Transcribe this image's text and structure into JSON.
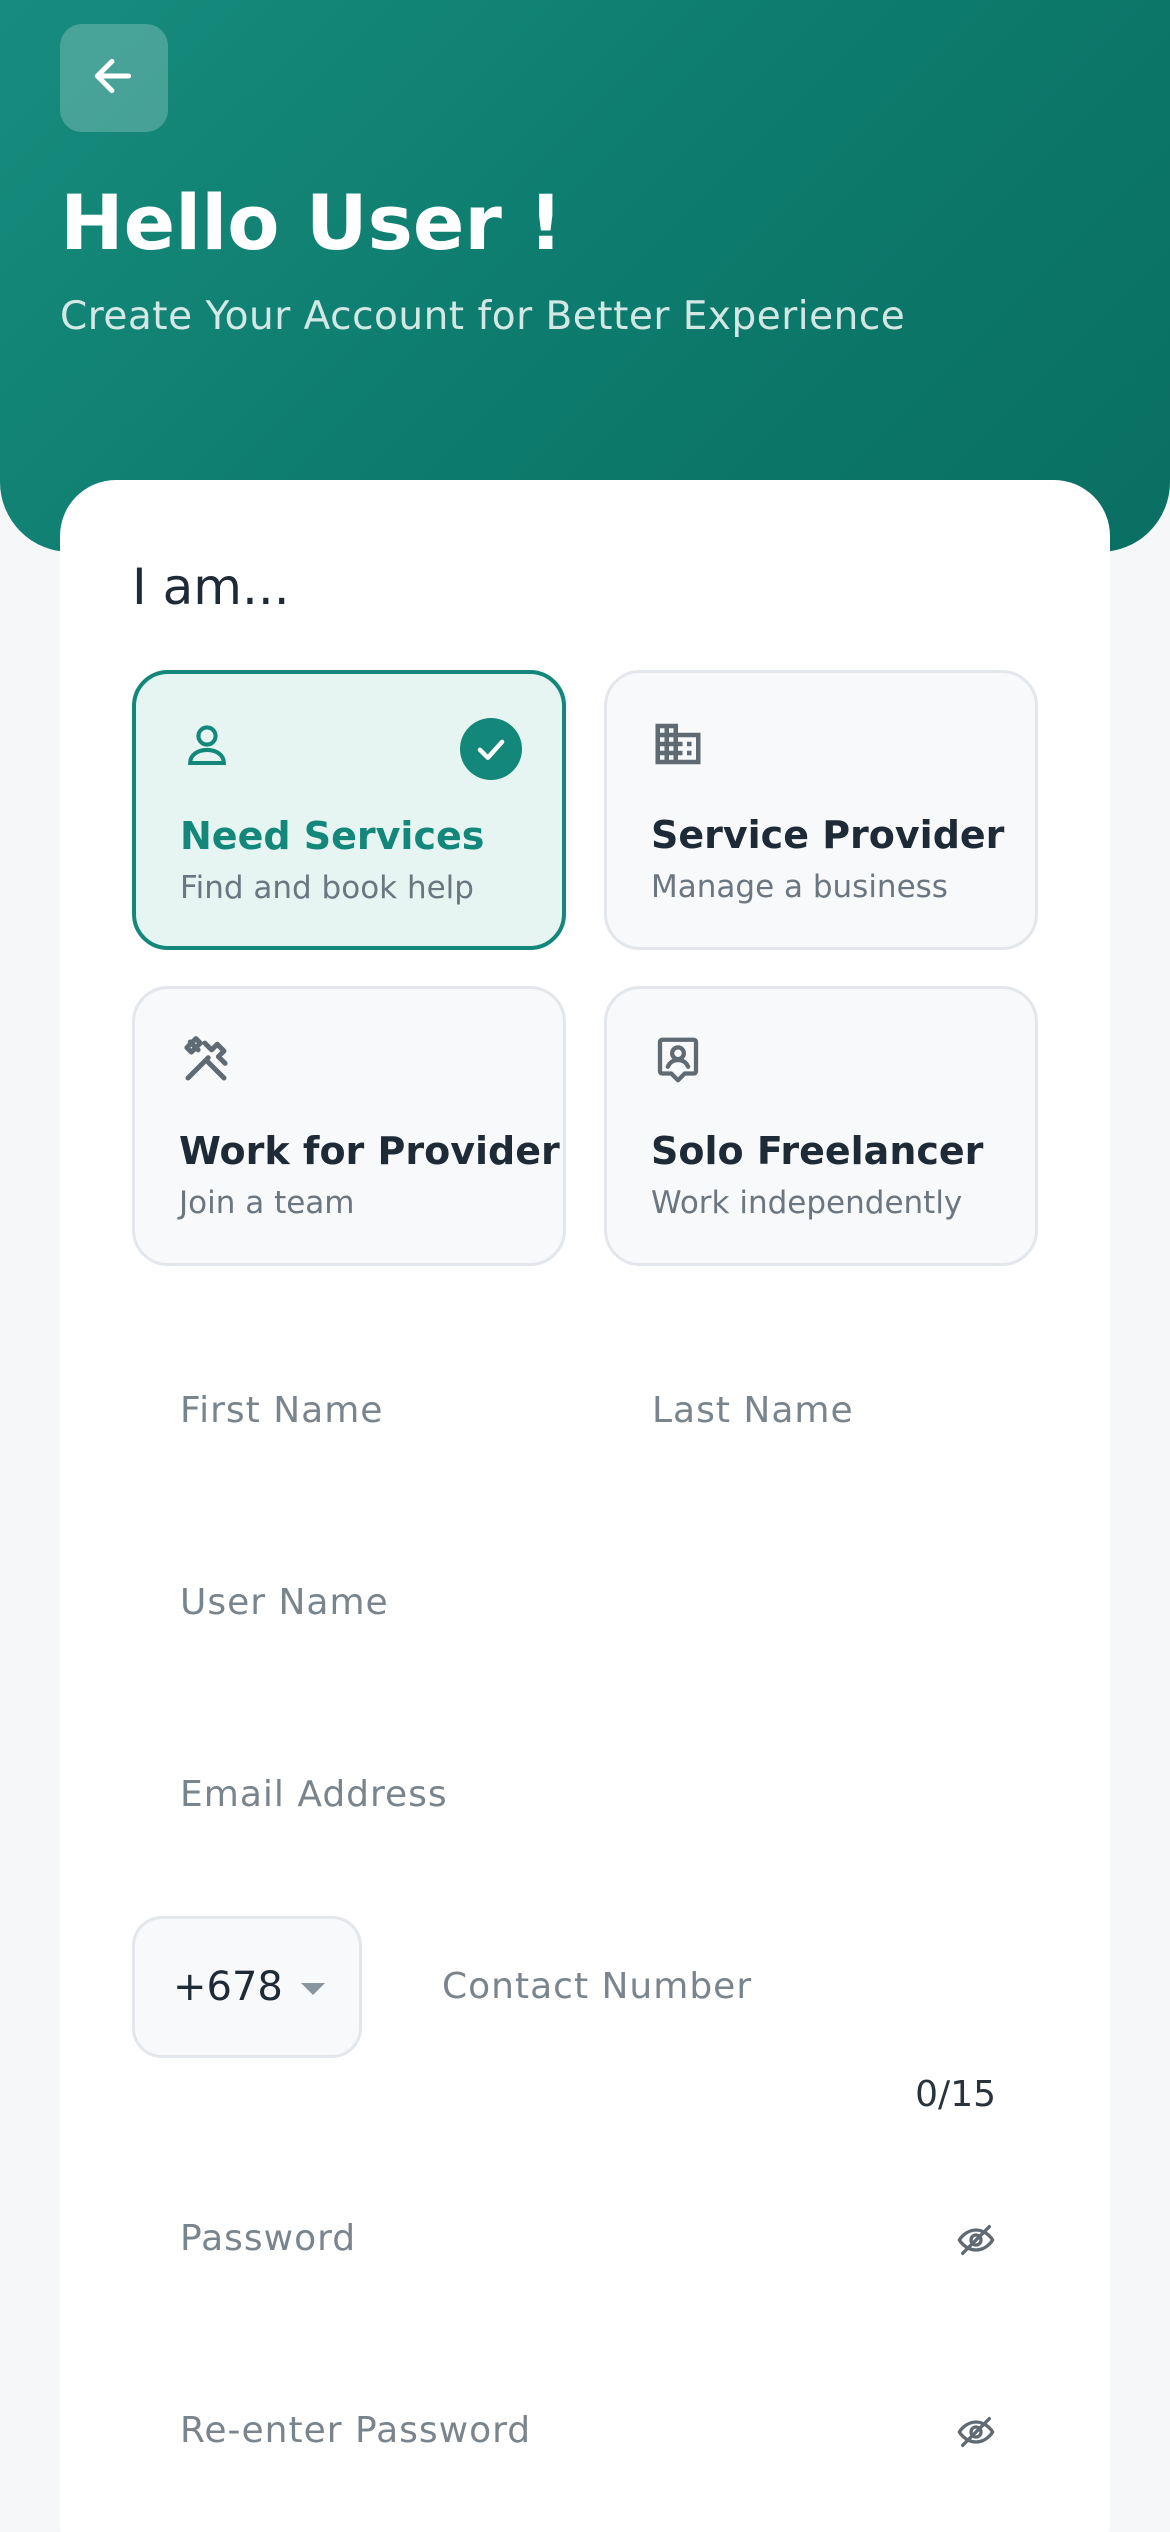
{
  "header": {
    "back_icon": "arrow-left-icon",
    "title": "Hello User !",
    "subtitle": "Create Your Account for Better Experience"
  },
  "form": {
    "role_heading": "I am...",
    "roles": [
      {
        "title": "Need Services",
        "description": "Find and book help",
        "icon": "person-icon",
        "selected": true
      },
      {
        "title": "Service Provider",
        "description": "Manage a business",
        "icon": "building-icon",
        "selected": false
      },
      {
        "title": "Work for Provider",
        "description": "Join a team",
        "icon": "tools-icon",
        "selected": false
      },
      {
        "title": "Solo Freelancer",
        "description": "Work independently",
        "icon": "badge-icon",
        "selected": false
      }
    ],
    "first_name_placeholder": "First Name",
    "last_name_placeholder": "Last Name",
    "username_placeholder": "User Name",
    "email_placeholder": "Email Address",
    "country_code": "+678",
    "contact_placeholder": "Contact Number",
    "contact_counter": "0/15",
    "password_placeholder": "Password",
    "reenter_password_placeholder": "Re-enter Password"
  },
  "colors": {
    "brand": "#12877A",
    "header_gradient_start": "#178C7E",
    "header_gradient_end": "#0A6F62",
    "selected_bg": "#E6F4F2"
  }
}
